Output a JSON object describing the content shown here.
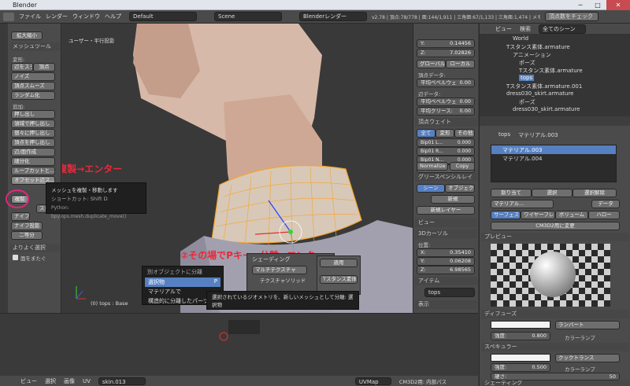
{
  "window": {
    "title": "Blender"
  },
  "topbar": {
    "menus": [
      "ファイル",
      "レンダー",
      "ウィンドウ",
      "ヘルプ"
    ],
    "layout": "Default",
    "scene": "Scene",
    "engine": "Blenderレンダー",
    "stats": "v2.78 | 頂点:78/778 | 面:144/1,911 | 三角面:67/1,133 | 三角面:1,474 | メモリ:89.84M | tops",
    "check": "頂点数をチェック"
  },
  "viewport": {
    "label": "ユーザー・平行投影",
    "obj_label": "(0) tops : Base",
    "header": [
      "ビュー",
      "選択",
      "追加",
      "メッシュ"
    ],
    "mode": "編集モード",
    "shading": "ノーマル"
  },
  "annotations": {
    "a1": "①複製→エンター",
    "a2": "②その場でPキー→分離→エンター"
  },
  "tools": {
    "header": "メッシュツール",
    "deform": "変形:",
    "move": "移動",
    "rotate": "回転",
    "scale": "拡大縮小",
    "rows": [
      [
        "辺をスライド",
        "頂点"
      ],
      [
        "ノイズ"
      ],
      [
        "頂点スムーズ"
      ],
      [
        "ランダム化"
      ]
    ],
    "add": "追加:",
    "extrude": "押し出し",
    "add_rows": [
      "領域で押し出し",
      "個々に押し出し",
      "頂点を押し出し",
      "辺/面作成",
      "細分化",
      "ループカットと...",
      "オフセット辺ス..."
    ],
    "dup": "複製",
    "spin": "スピン",
    "knife": "ナイフ",
    "knife_select": "ナイフ投影",
    "cut": "二等分",
    "select_ops": "よりよく選択",
    "bridge": "面をまたぐ",
    "tabs": [
      "ツール",
      "作成",
      "関係",
      "アニメ",
      "物理",
      "グリースペンシル",
      "Quick"
    ]
  },
  "tooltip1": {
    "title": "メッシュを複製・移動します",
    "shortcut": "ショートカット: Shift D",
    "py": "Python: bpy.ops.mesh.duplicate_move()"
  },
  "sep_menu": {
    "title": "別オブジェクトに分離",
    "items": [
      "選択物",
      "マテリアルで",
      "構造的に分離したパーツで"
    ],
    "key": "P"
  },
  "tooltip2": {
    "text": "選択されているジオメトリを、新しいメッシュとして分離: 選択物",
    "py": "Python: bpy.ops.mesh.separate(type='SELECTED')"
  },
  "props": {
    "y_label": "Y:",
    "y_val": "0.14456",
    "z_label": "Z:",
    "z_val": "7.02826",
    "global": "グローバル",
    "local": "ローカル",
    "vdata": "頂点データ:",
    "bevel_w": "平均ベベルウェ",
    "bevel_v": "0.00",
    "edata": "辺データ:",
    "bevel_w2": "平均ベベルウェ",
    "bevel_v2": "0.00",
    "crease": "平均クリース:",
    "crease_v": "0.00",
    "weights": "頂点ウェイト",
    "w_tabs": [
      "全て",
      "変形",
      "その他"
    ],
    "w_rows": [
      "Bip01 L...",
      "Bip01 R...",
      "Bip01 N...",
      "Bip01 L..."
    ],
    "w_vals": [
      "0.000",
      "0.000",
      "0.000",
      "0.000"
    ],
    "normalize": "Normalize",
    "copy": "Copy",
    "gp": "グリースペンシルレイ",
    "gp_tabs": [
      "シーン",
      "オブジェクト"
    ],
    "new": "新規",
    "new_layer": "新規レイヤー",
    "view": "ビュー",
    "cursor3d": "3Dカーソル",
    "loc": "位置:",
    "cx": "0.35410",
    "cy": "0.06208",
    "cz": "6.98565",
    "item": "アイテム",
    "item_name": "tops",
    "display": "表示"
  },
  "shading_panel": {
    "title": "シェーディング",
    "multi": "マルチテクスチャ",
    "tex": "テクスチャソリッド",
    "apply": "適用",
    "name": "Tスタンス素体"
  },
  "outliner": {
    "header": [
      "ビュー",
      "検索",
      "全てのシーン"
    ],
    "items": [
      "World",
      "Tスタンス素体.armature",
      "アニメーション",
      "ポーズ",
      "Tスタンス素体.armature",
      "tops",
      "Tスタンス素体.armature.001",
      "dress030_skirt.armature",
      "ポーズ",
      "dress030_skirt.armature"
    ]
  },
  "material": {
    "crumb1": "tops",
    "crumb2": "マテリアル.003",
    "slots": [
      "マテリアル.003",
      "マテリアル.004"
    ],
    "assign": "割り当て",
    "select": "選択",
    "deselect": "選択解除",
    "name": "マテリアル...",
    "data": "データ",
    "tabs": [
      "サーフェス",
      "ワイヤーフレ",
      "ボリューム",
      "ハロー"
    ],
    "cm3d2": "CM3D2用に変更",
    "preview": "プレビュー",
    "diffuse": "ディフューズ",
    "lambert": "ランバート",
    "intensity": "強度:",
    "int_val": "0.800",
    "ramp": "カラーランプ",
    "specular": "スペキュラー",
    "cooktorr": "クックトランス",
    "spec_val": "0.500",
    "hard": "硬さ:",
    "hard_val": "50",
    "shading": "シェーディング"
  },
  "uv": {
    "header": [
      "ビュー",
      "選択",
      "画像",
      "UV"
    ],
    "img": "skin.013",
    "uvmap": "UVMap",
    "cm3d2": "CM3D2用: 内部パス"
  },
  "colors": {
    "accent": "#5680c2",
    "orange": "#f5a42a",
    "red": "#e8293a"
  }
}
